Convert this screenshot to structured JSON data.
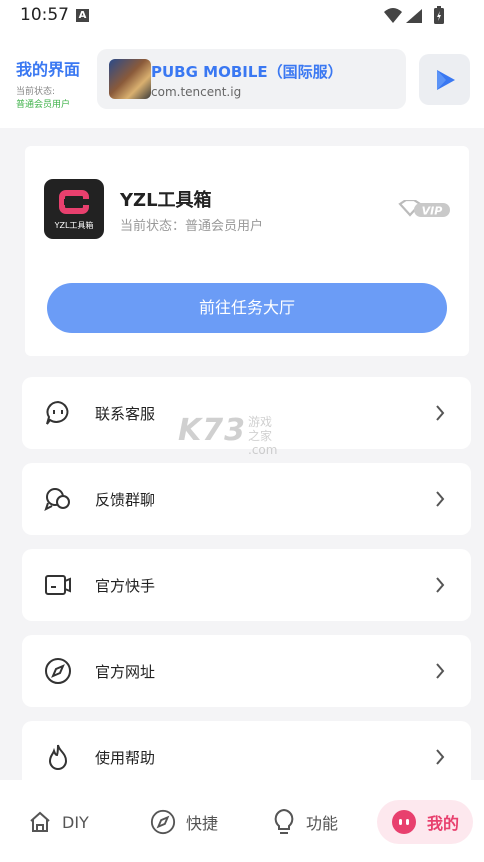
{
  "status_bar": {
    "time": "10:57"
  },
  "header": {
    "title": "我的界面",
    "status_label": "当前状态:",
    "status_value": "普通会员用户",
    "game_name": "PUBG MOBILE（国际服）",
    "game_package": "com.tencent.ig",
    "play_icon": "play-icon"
  },
  "member": {
    "logo_text": "YZL工具箱",
    "name": "YZL工具箱",
    "status": "当前状态：普通会员用户",
    "vip_badge": "VIP",
    "task_button": "前往任务大厅"
  },
  "menu": [
    {
      "label": "联系客服",
      "icon": "chat-bubble-icon"
    },
    {
      "label": "反馈群聊",
      "icon": "group-chat-icon"
    },
    {
      "label": "官方快手",
      "icon": "video-camera-icon"
    },
    {
      "label": "官方网址",
      "icon": "compass-icon"
    },
    {
      "label": "使用帮助",
      "icon": "flame-icon"
    }
  ],
  "watermark": {
    "main": "K73",
    "line1": "游戏之家",
    "line2": ".com"
  },
  "bottom_nav": [
    {
      "label": "DIY",
      "icon": "home-icon"
    },
    {
      "label": "快捷",
      "icon": "compass-icon"
    },
    {
      "label": "功能",
      "icon": "lightbulb-icon"
    },
    {
      "label": "我的",
      "icon": "robot-face-icon"
    }
  ],
  "colors": {
    "accent": "#3a78f2",
    "button": "#6b9cf6",
    "active_nav": "#e8406e",
    "status_green": "#3fb24a"
  }
}
